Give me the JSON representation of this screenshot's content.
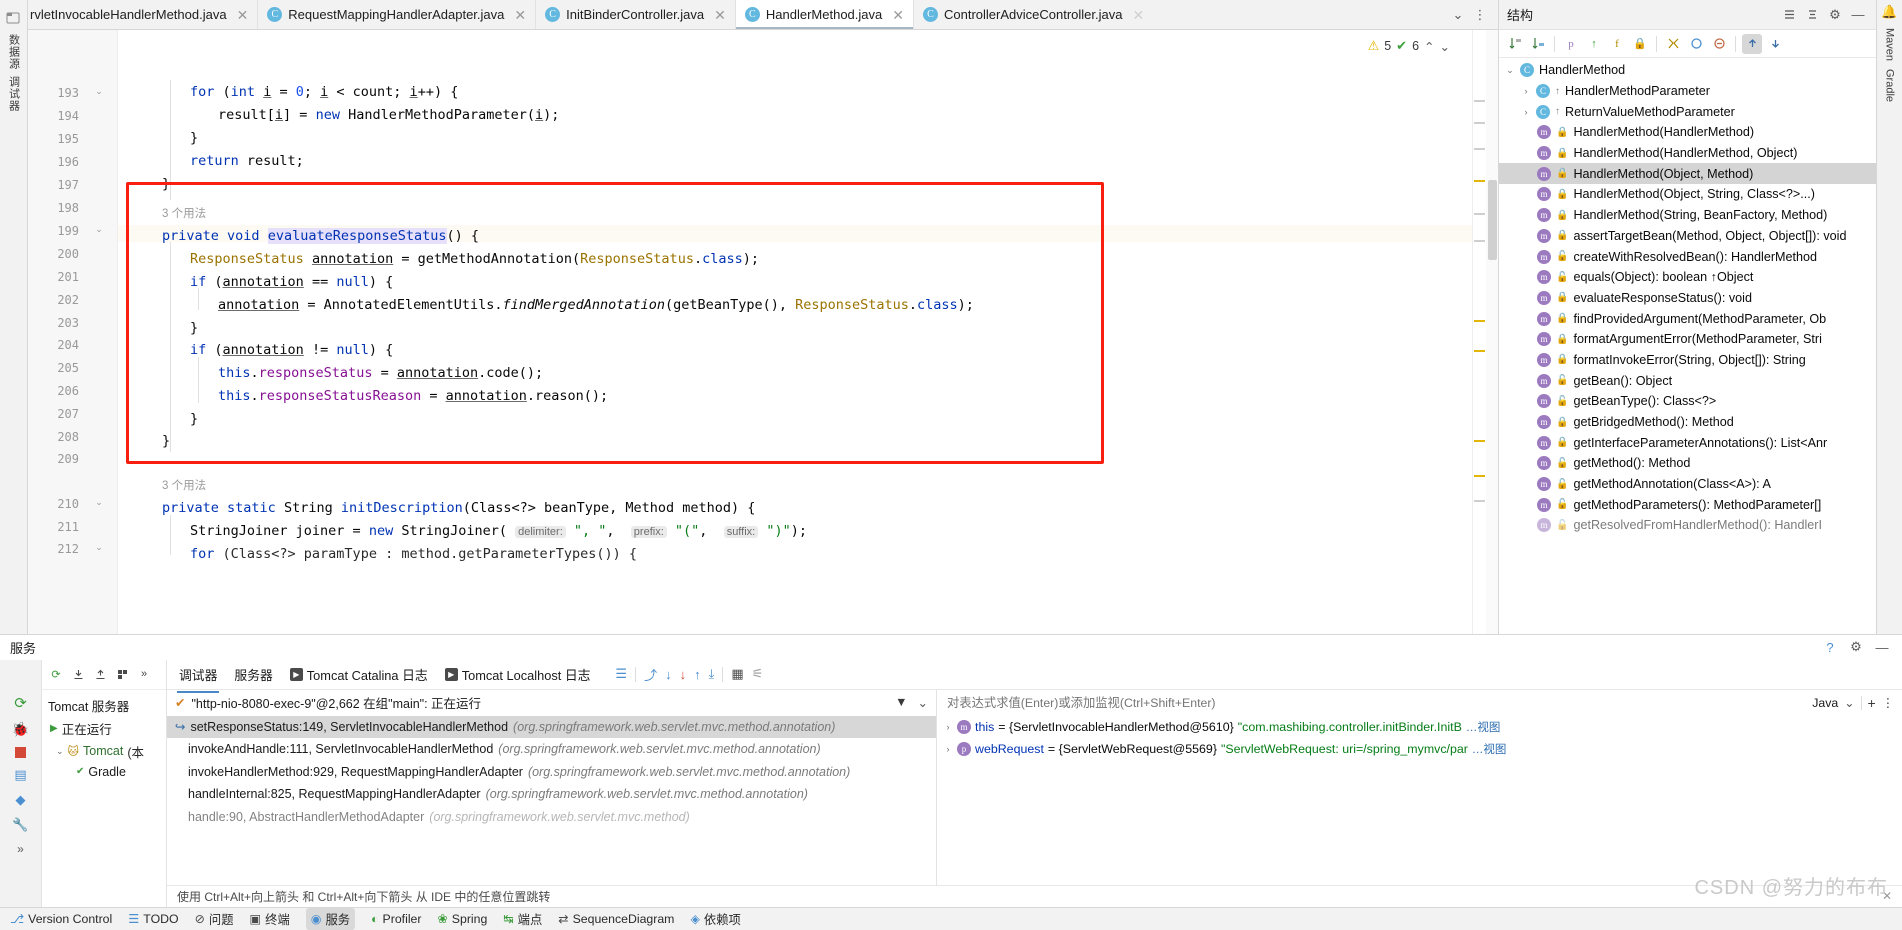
{
  "window": {
    "left_rail": [
      "数据源",
      "调试器"
    ],
    "right_rail": [
      "Maven",
      "Gradle"
    ]
  },
  "tabs": {
    "items": [
      {
        "label": "rvletInvocableHandlerMethod.java",
        "icon": "java-class-icon",
        "active": false,
        "clipped": true
      },
      {
        "label": "RequestMappingHandlerAdapter.java",
        "icon": "java-class-icon",
        "active": false
      },
      {
        "label": "InitBinderController.java",
        "icon": "java-class-icon",
        "active": false
      },
      {
        "label": "HandlerMethod.java",
        "icon": "java-class-icon",
        "active": true
      },
      {
        "label": "ControllerAdviceController.java",
        "icon": "java-class-icon",
        "active": false
      }
    ],
    "overflow_chevron": "⌄",
    "more_menu": "⋮"
  },
  "inspections": {
    "warning_icon": "warning-triangle-icon",
    "warning_count": "5",
    "ok_icon": "check-icon",
    "ok_count": "6",
    "prev": "⌃",
    "next": "⌄"
  },
  "editor": {
    "line_numbers": [
      "193",
      "194",
      "195",
      "196",
      "197",
      "198",
      "199",
      "200",
      "201",
      "202",
      "203",
      "204",
      "205",
      "206",
      "207",
      "208",
      "209",
      "210",
      "211",
      "212"
    ],
    "usage_hint_1": "3 个用法",
    "usage_hint_2": "3 个用法",
    "param_hints": {
      "delimiter": "delimiter:",
      "prefix": "prefix:",
      "suffix": "suffix:"
    },
    "code": {
      "l193": "for (int i = 0; i < count; i++) {",
      "l194": "result[i] = new HandlerMethodParameter(i);",
      "l195": "}",
      "l196": "return result;",
      "l197": "}",
      "l199": "private void evaluateResponseStatus() {",
      "l200": "ResponseStatus annotation = getMethodAnnotation(ResponseStatus.class);",
      "l201": "if (annotation == null) {",
      "l202": "annotation = AnnotatedElementUtils.findMergedAnnotation(getBeanType(), ResponseStatus.class);",
      "l203": "}",
      "l204": "if (annotation != null) {",
      "l205": "this.responseStatus = annotation.code();",
      "l206": "this.responseStatusReason = annotation.reason();",
      "l207": "}",
      "l208": "}",
      "l210": "private static String initDescription(Class<?> beanType, Method method) {",
      "l211": "StringJoiner joiner = new StringJoiner( delimiter: \", \",  prefix: \"(\",  suffix: \")\");",
      "l212": "for (Class<?> paramType : method.getParameterTypes()) {"
    },
    "highlight_color": "#fa1e0e"
  },
  "structure": {
    "title": "结构",
    "toolbar_icons": [
      "sort-alpha-icon",
      "sort-type-icon",
      "show-properties-icon",
      "show-fields-icon",
      "show-nonpublic-icon",
      "show-inherited-icon",
      "show-anonymous-icon",
      "group-icon",
      "filter-icon",
      "expand-all-icon",
      "collapse-all-icon"
    ],
    "header_actions": [
      "settings-icon",
      "minimize-icon"
    ],
    "tree": [
      {
        "label": "HandlerMethod",
        "kind": "class",
        "depth": 0,
        "arrow": "⌄",
        "selected": false
      },
      {
        "label": "HandlerMethodParameter",
        "kind": "class",
        "depth": 1,
        "arrow": "›",
        "selected": false,
        "inherit": true
      },
      {
        "label": "ReturnValueMethodParameter",
        "kind": "class",
        "depth": 1,
        "arrow": "›",
        "selected": false,
        "inherit": true
      },
      {
        "label": "HandlerMethod(HandlerMethod)",
        "kind": "method",
        "depth": 1,
        "arrow": "",
        "selected": false,
        "lock": true
      },
      {
        "label": "HandlerMethod(HandlerMethod, Object)",
        "kind": "method",
        "depth": 1,
        "arrow": "",
        "selected": false,
        "lock": true
      },
      {
        "label": "HandlerMethod(Object, Method)",
        "kind": "method",
        "depth": 1,
        "arrow": "",
        "selected": true,
        "lock": true
      },
      {
        "label": "HandlerMethod(Object, String, Class<?>...)",
        "kind": "method",
        "depth": 1,
        "arrow": "",
        "selected": false,
        "lock": true
      },
      {
        "label": "HandlerMethod(String, BeanFactory, Method)",
        "kind": "method",
        "depth": 1,
        "arrow": "",
        "selected": false,
        "lock": true
      },
      {
        "label": "assertTargetBean(Method, Object, Object[]): void",
        "kind": "method",
        "depth": 1,
        "arrow": "",
        "selected": false,
        "lock": true
      },
      {
        "label": "createWithResolvedBean(): HandlerMethod",
        "kind": "method",
        "depth": 1,
        "arrow": "",
        "selected": false
      },
      {
        "label": "equals(Object): boolean ↑Object",
        "kind": "method",
        "depth": 1,
        "arrow": "",
        "selected": false
      },
      {
        "label": "evaluateResponseStatus(): void",
        "kind": "method",
        "depth": 1,
        "arrow": "",
        "selected": false,
        "lock": true
      },
      {
        "label": "findProvidedArgument(MethodParameter, Ob",
        "kind": "method",
        "depth": 1,
        "arrow": "",
        "selected": false,
        "static": true
      },
      {
        "label": "formatArgumentError(MethodParameter, Stri",
        "kind": "method",
        "depth": 1,
        "arrow": "",
        "selected": false,
        "static": true
      },
      {
        "label": "formatInvokeError(String, Object[]): String",
        "kind": "method",
        "depth": 1,
        "arrow": "",
        "selected": false,
        "lock": true
      },
      {
        "label": "getBean(): Object",
        "kind": "method",
        "depth": 1,
        "arrow": "",
        "selected": false
      },
      {
        "label": "getBeanType(): Class<?>",
        "kind": "method",
        "depth": 1,
        "arrow": "",
        "selected": false
      },
      {
        "label": "getBridgedMethod(): Method",
        "kind": "method",
        "depth": 1,
        "arrow": "",
        "selected": false,
        "lock": true
      },
      {
        "label": "getInterfaceParameterAnnotations(): List<Anr",
        "kind": "method",
        "depth": 1,
        "arrow": "",
        "selected": false,
        "lock": true
      },
      {
        "label": "getMethod(): Method",
        "kind": "method",
        "depth": 1,
        "arrow": "",
        "selected": false
      },
      {
        "label": "getMethodAnnotation(Class<A>): A",
        "kind": "method",
        "depth": 1,
        "arrow": "",
        "selected": false
      },
      {
        "label": "getMethodParameters(): MethodParameter[]",
        "kind": "method",
        "depth": 1,
        "arrow": "",
        "selected": false
      },
      {
        "label": "getResolvedFromHandlerMethod(): HandlerI",
        "kind": "method",
        "depth": 1,
        "arrow": "",
        "selected": false
      }
    ]
  },
  "services": {
    "title": "服务",
    "header_actions": [
      "help-icon",
      "settings-icon",
      "minimize-icon"
    ],
    "left_toolbar": [
      "rerun-icon",
      "expand-icon",
      "collapse-icon",
      "layout-icon",
      "more-icon"
    ],
    "tree": [
      {
        "label": "Tomcat 服务器",
        "depth": 0,
        "icon": ""
      },
      {
        "label": "正在运行",
        "depth": 1,
        "icon": "run-icon",
        "arrow": "▶"
      },
      {
        "label": "Tomcat",
        "depth": 2,
        "icon": "tomcat-icon",
        "arrow": "⌄",
        "suffix": "(本"
      },
      {
        "label": "Gradle",
        "depth": 3,
        "icon": "gradle-icon"
      }
    ],
    "rail_icons": [
      "rerun-icon",
      "bug-icon",
      "stop-icon",
      "thread-icon",
      "layers-icon",
      "wrench-icon",
      "chevron-icon"
    ],
    "tabs": [
      {
        "label": "调试器",
        "active": true
      },
      {
        "label": "服务器",
        "active": false
      },
      {
        "label": "Tomcat Catalina 日志",
        "active": false,
        "icon": "console-icon"
      },
      {
        "label": "Tomcat Localhost 日志",
        "active": false,
        "icon": "console-icon"
      }
    ],
    "tab_actions": [
      "mute-breakpoints-icon",
      "step-over-icon",
      "step-into-icon",
      "force-step-into-icon",
      "step-out-icon",
      "run-to-cursor-icon",
      "evaluate-icon",
      "settings-icon"
    ],
    "thread": {
      "status_icon": "check-icon",
      "text": "\"http-nio-8080-exec-9\"@2,662 在组\"main\": 正在运行",
      "filter_icon": "filter-icon",
      "chevron": "⌄"
    },
    "frames": [
      {
        "method": "setResponseStatus:149, ServletInvocableHandlerMethod",
        "pkg": "(org.springframework.web.servlet.mvc.method.annotation)",
        "selected": true,
        "arrow": "↪"
      },
      {
        "method": "invokeAndHandle:111, ServletInvocableHandlerMethod",
        "pkg": "(org.springframework.web.servlet.mvc.method.annotation)",
        "selected": false
      },
      {
        "method": "invokeHandlerMethod:929, RequestMappingHandlerAdapter",
        "pkg": "(org.springframework.web.servlet.mvc.method.annotation)",
        "selected": false
      },
      {
        "method": "handleInternal:825, RequestMappingHandlerAdapter",
        "pkg": "(org.springframework.web.servlet.mvc.method.annotation)",
        "selected": false
      },
      {
        "method": "handle:90, AbstractHandlerMethodAdapter",
        "pkg": "(org.springframework.web.servlet.mvc.method)",
        "selected": false
      }
    ],
    "variables": {
      "placeholder": "对表达式求值(Enter)或添加监视(Ctrl+Shift+Enter)",
      "language": "Java",
      "lang_chevron": "⌄",
      "add_icon": "+",
      "more_icon": "⋮",
      "rows": [
        {
          "arrow": "›",
          "badge": "this",
          "badge_kind": "m",
          "name": "this",
          "value": "= {ServletInvocableHandlerMethod@5610}",
          "str": "\"com.mashibing.controller.initBinder.InitB",
          "link": "…视图"
        },
        {
          "arrow": "›",
          "badge": "p",
          "badge_kind": "p",
          "name": "webRequest",
          "value": "= {ServletWebRequest@5569}",
          "str": "\"ServletWebRequest: uri=/spring_mymvc/par",
          "link": "…视图"
        }
      ]
    },
    "hint": "使用 Ctrl+Alt+向上箭头 和 Ctrl+Alt+向下箭头 从 IDE 中的任意位置跳转"
  },
  "statusbar": {
    "items": [
      {
        "label": "Version Control",
        "icon": "vcs-icon",
        "active": false
      },
      {
        "label": "TODO",
        "icon": "todo-icon",
        "active": false
      },
      {
        "label": "问题",
        "icon": "problems-icon",
        "active": false
      },
      {
        "label": "终端",
        "icon": "terminal-icon",
        "active": false
      },
      {
        "label": "服务",
        "icon": "services-icon",
        "active": true
      },
      {
        "label": "Profiler",
        "icon": "profiler-icon",
        "active": false
      },
      {
        "label": "Spring",
        "icon": "spring-icon",
        "active": false
      },
      {
        "label": "端点",
        "icon": "endpoints-icon",
        "active": false
      },
      {
        "label": "SequenceDiagram",
        "icon": "diagram-icon",
        "active": false
      },
      {
        "label": "依赖项",
        "icon": "dependencies-icon",
        "active": false
      }
    ]
  },
  "watermark": "CSDN @努力的布布"
}
